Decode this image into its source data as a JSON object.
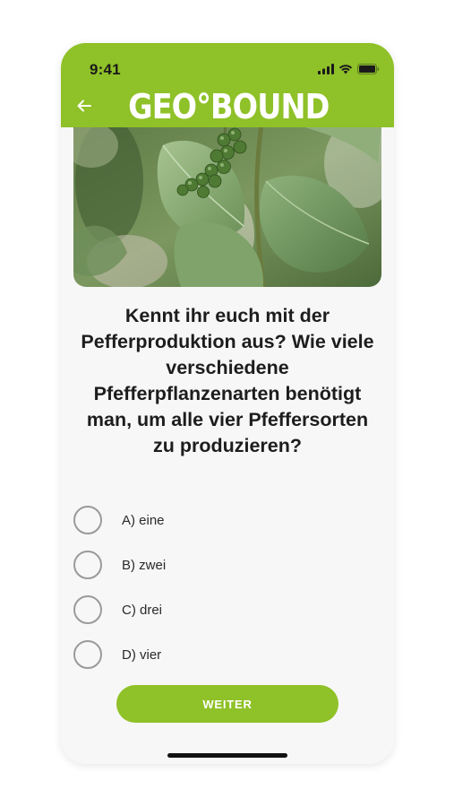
{
  "status_bar": {
    "time": "9:41",
    "icons": [
      "signal-icon",
      "wifi-icon",
      "battery-icon"
    ]
  },
  "header": {
    "back_icon": "arrow-left-icon",
    "logo_text": "GEO°BOUND"
  },
  "quiz": {
    "question": "Kennt ihr euch mit der Pefferproduktion aus? Wie viele verschiedene Pfefferpflanzenarten benötigt man, um alle vier Pfeffersorten zu produzieren?",
    "answers": [
      {
        "label": "A) eine"
      },
      {
        "label": "B) zwei"
      },
      {
        "label": "C) drei"
      },
      {
        "label": "D) vier"
      }
    ],
    "next_label": "WEITER"
  },
  "colors": {
    "accent": "#8fc128",
    "text": "#1d1d1d",
    "background": "#f7f7f7"
  }
}
